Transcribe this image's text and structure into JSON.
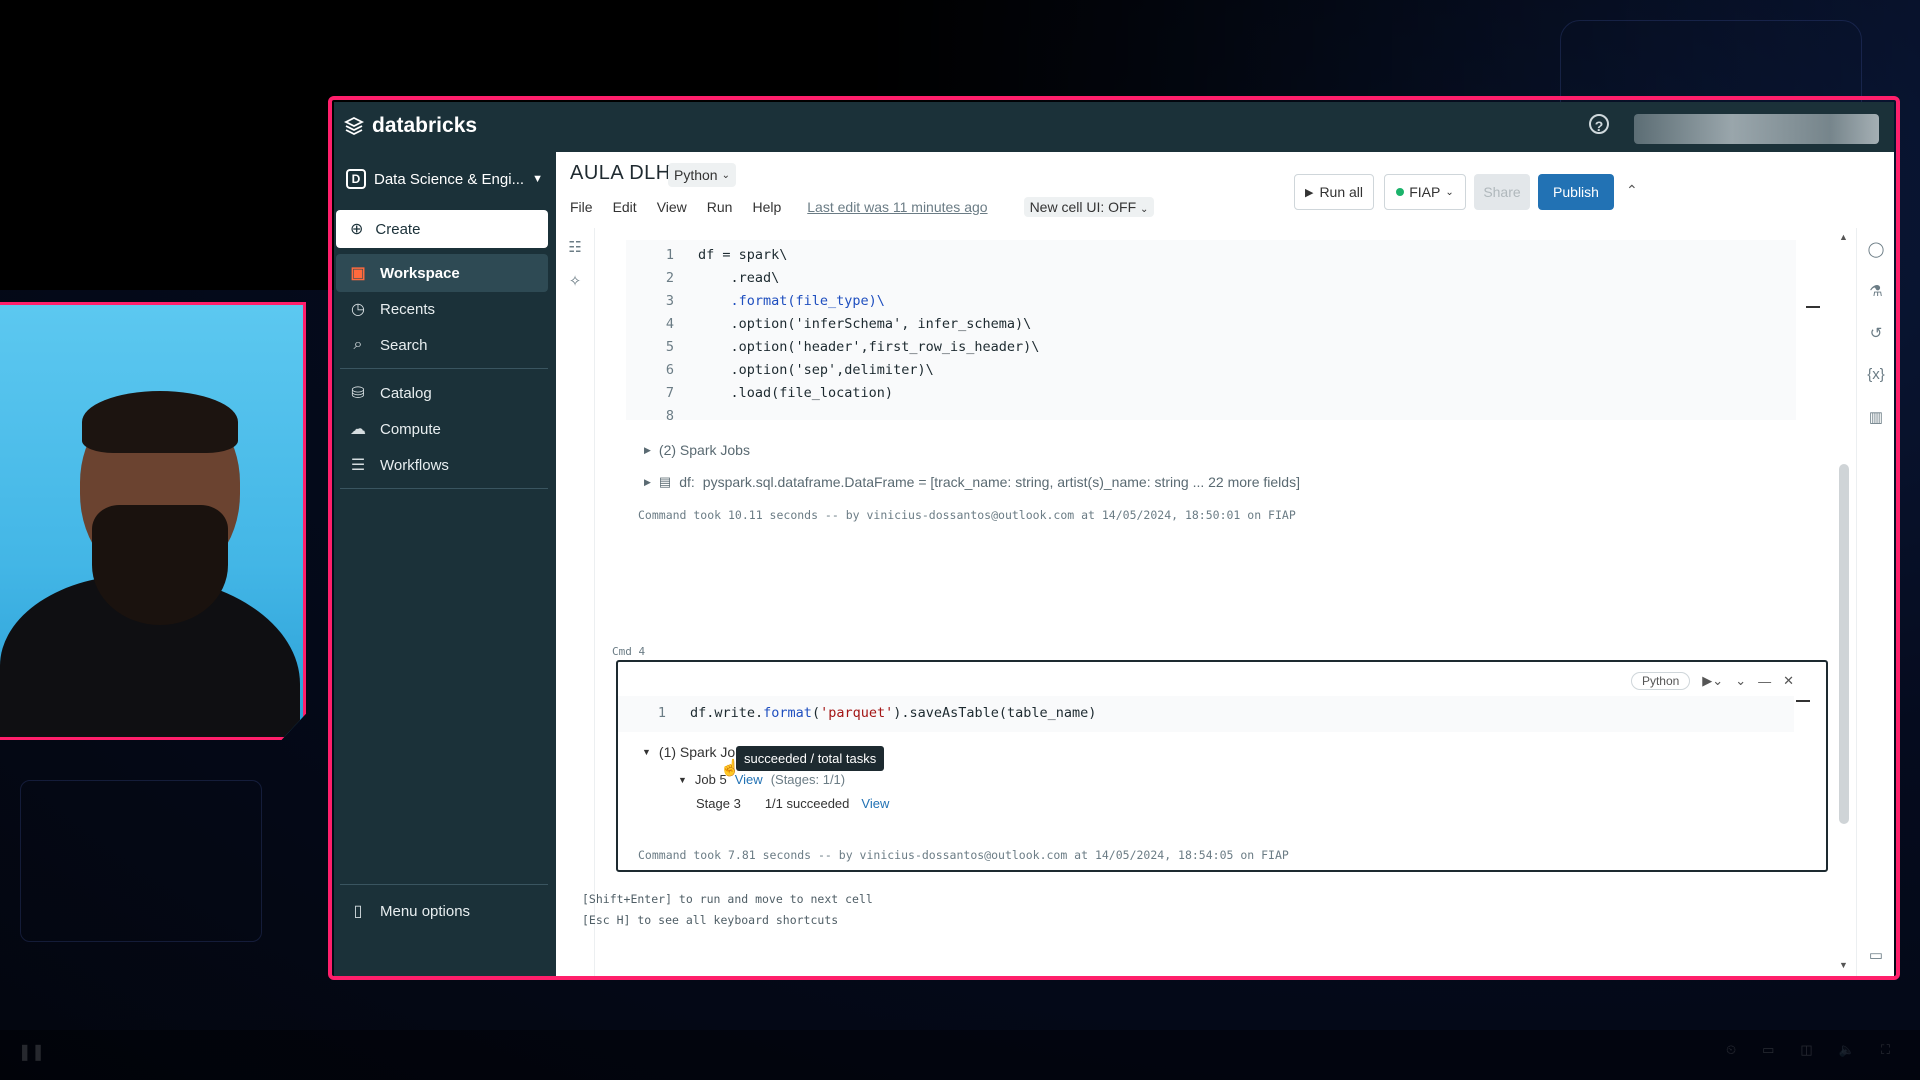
{
  "app": {
    "logo_text": "databricks"
  },
  "sidebar": {
    "workspace_switch": {
      "letter": "D",
      "label": "Data Science & Engi..."
    },
    "create_label": "Create",
    "items": [
      {
        "label": "Workspace",
        "icon": "workspace-icon",
        "active": true
      },
      {
        "label": "Recents",
        "icon": "clock-icon"
      },
      {
        "label": "Search",
        "icon": "search-icon"
      },
      {
        "label": "Catalog",
        "icon": "catalog-icon"
      },
      {
        "label": "Compute",
        "icon": "compute-icon"
      },
      {
        "label": "Workflows",
        "icon": "workflows-icon"
      }
    ],
    "menu_options_label": "Menu options"
  },
  "notebook": {
    "title": "AULA DLH",
    "language": "Python",
    "menu": [
      "File",
      "Edit",
      "View",
      "Run",
      "Help"
    ],
    "last_edit": "Last edit was 11 minutes ago",
    "new_cell_ui": "New cell UI: OFF",
    "run_all_label": "Run all",
    "cluster_label": "FIAP",
    "share_label": "Share",
    "publish_label": "Publish"
  },
  "cell1": {
    "lines": [
      {
        "n": "1",
        "code": "df = spark\\"
      },
      {
        "n": "2",
        "code": "    .read\\"
      },
      {
        "n": "3",
        "code": "    .format(file_type)\\"
      },
      {
        "n": "4",
        "code": "    .option('inferSchema', infer_schema)\\"
      },
      {
        "n": "5",
        "code": "    .option('header',first_row_is_header)\\"
      },
      {
        "n": "6",
        "code": "    .option('sep',delimiter)\\"
      },
      {
        "n": "7",
        "code": "    .load(file_location)"
      },
      {
        "n": "8",
        "code": ""
      }
    ],
    "spark_jobs": "(2) Spark Jobs",
    "df_label": "df:",
    "df_schema": "pyspark.sql.dataframe.DataFrame = [track_name: string, artist(s)_name: string ... 22 more fields]",
    "meta": "Command took 10.11 seconds -- by vinicius-dossantos@outlook.com at 14/05/2024, 18:50:01 on FIAP"
  },
  "cmd_label": "Cmd 4",
  "cell2": {
    "language": "Python",
    "line_no": "1",
    "spark_jobs": "(1) Spark Jo",
    "job_label": "Job 5",
    "job_view": "View",
    "job_stages": "(Stages: 1/1)",
    "stage_label": "Stage 3",
    "stage_status": "1/1 succeeded",
    "stage_view": "View",
    "tooltip": "succeeded / total tasks",
    "meta": "Command took 7.81 seconds -- by vinicius-dossantos@outlook.com at 14/05/2024, 18:54:05 on FIAP"
  },
  "hints": {
    "line1": "[Shift+Enter] to run and move to next cell",
    "line2": "[Esc H] to see all keyboard shortcuts"
  },
  "colors": {
    "frame": "#ff1f6b",
    "sidebar_bg": "#1b3139",
    "publish": "#2272b4"
  }
}
